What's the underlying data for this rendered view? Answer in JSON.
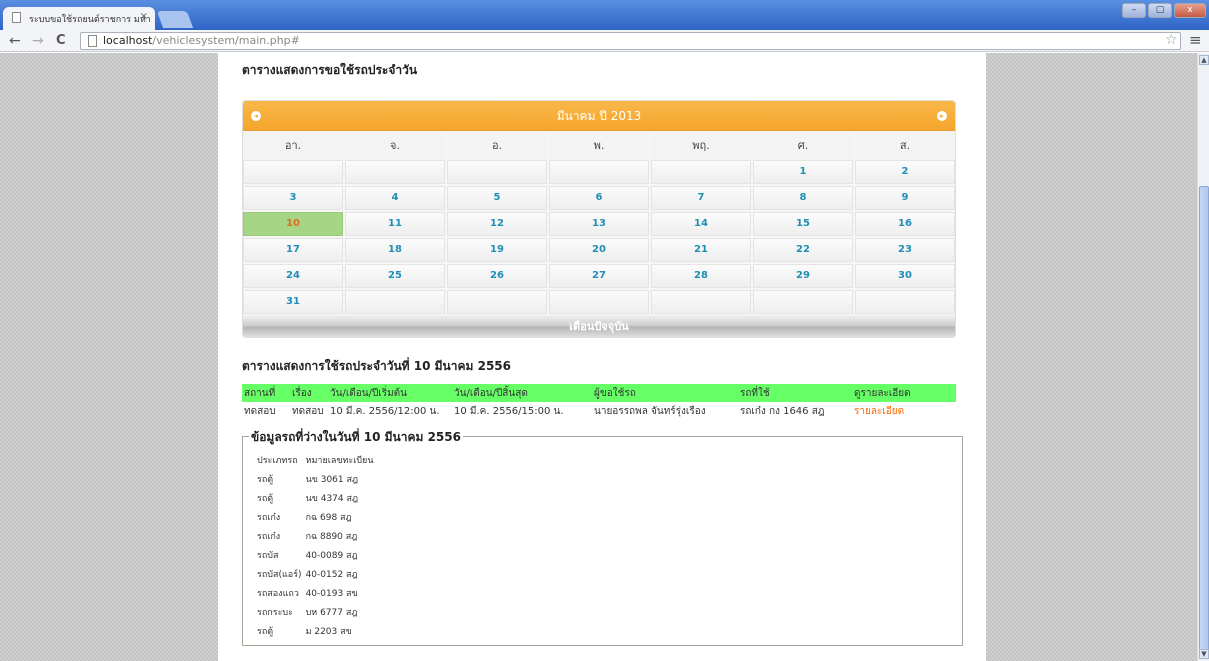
{
  "browser": {
    "tab_title": "ระบบขอใช้รถยนต์ราชการ มหา",
    "tab_close": "×",
    "url_host": "localhost",
    "url_path": "/vehiclesystem/main.php#",
    "back": "←",
    "forward": "→",
    "reload": "C",
    "star": "☆",
    "menu": "≡",
    "win_min": "–",
    "win_max": "▢",
    "win_close": "x"
  },
  "page": {
    "title": "ตารางแสดงการขอใช้รถประจำวัน"
  },
  "calendar": {
    "month_label": "มีนาคม ปี 2013",
    "prev_icon": "◂",
    "next_icon": "▸",
    "weekdays": [
      "อา.",
      "จ.",
      "อ.",
      "พ.",
      "พฤ.",
      "ศ.",
      "ส."
    ],
    "weeks": [
      [
        "",
        "",
        "",
        "",
        "",
        "1",
        "2"
      ],
      [
        "3",
        "4",
        "5",
        "6",
        "7",
        "8",
        "9"
      ],
      [
        "10",
        "11",
        "12",
        "13",
        "14",
        "15",
        "16"
      ],
      [
        "17",
        "18",
        "19",
        "20",
        "21",
        "22",
        "23"
      ],
      [
        "24",
        "25",
        "26",
        "27",
        "28",
        "29",
        "30"
      ],
      [
        "31",
        "",
        "",
        "",
        "",
        "",
        ""
      ]
    ],
    "selected_day": "10",
    "current_month_button": "เดือนปัจจุบัน",
    "colors": {
      "header": "#f4a52b",
      "selected": "#a6d685",
      "day_text": "#1f8fb5",
      "selected_text": "#e36b1f"
    }
  },
  "usage": {
    "heading": "ตารางแสดงการใช้รถประจำวันที่ 10 มีนาคม 2556",
    "columns": [
      "สถานที่",
      "เรื่อง",
      "วัน/เดือน/ปีเริ่มต้น",
      "วัน/เดือน/ปีสิ้นสุด",
      "ผู้ขอใช้รถ",
      "รถที่ใช้",
      "ดูรายละเอียด"
    ],
    "rows": [
      [
        "ทดสอบ",
        "ทดสอบ",
        "10 มี.ค. 2556/12:00 น.",
        "10 มี.ค. 2556/15:00 น.",
        "นายอรรถพล จันทร์รุ่งเรือง",
        "รถเก๋ง กง 1646 สฎ",
        "รายละเอียด"
      ]
    ],
    "header_color": "#66ff66",
    "link_color": "#ff6600"
  },
  "free_cars": {
    "legend": "ข้อมูลรถที่ว่างในวันที่ 10 มีนาคม 2556",
    "header": [
      "ประเภทรถ",
      "หมายเลขทะเบียน"
    ],
    "rows": [
      [
        "รถตู้",
        "นข 3061 สฎ"
      ],
      [
        "รถตู้",
        "นข 4374 สฎ"
      ],
      [
        "รถเก๋ง",
        "กฉ 698 สฎ"
      ],
      [
        "รถเก๋ง",
        "กฉ 8890 สฎ"
      ],
      [
        "รถบัส",
        "40-0089 สฎ"
      ],
      [
        "รถบัส(แอร์)",
        "40-0152 สฎ"
      ],
      [
        "รถสองแถว",
        "40-0193 สข"
      ],
      [
        "รถกระบะ",
        "บห 6777 สฎ"
      ],
      [
        "รถตู้",
        "ม 2203 สข"
      ]
    ]
  }
}
